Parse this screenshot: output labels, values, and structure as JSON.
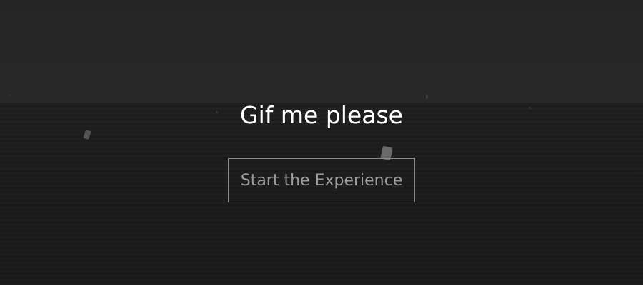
{
  "hero": {
    "title": "Gif me please",
    "cta_label": "Start the Experience"
  },
  "colors": {
    "background": "#1b1b1b",
    "title_text": "#ffffff",
    "button_border": "#8a8a8a",
    "button_text": "#9c9c9c"
  }
}
